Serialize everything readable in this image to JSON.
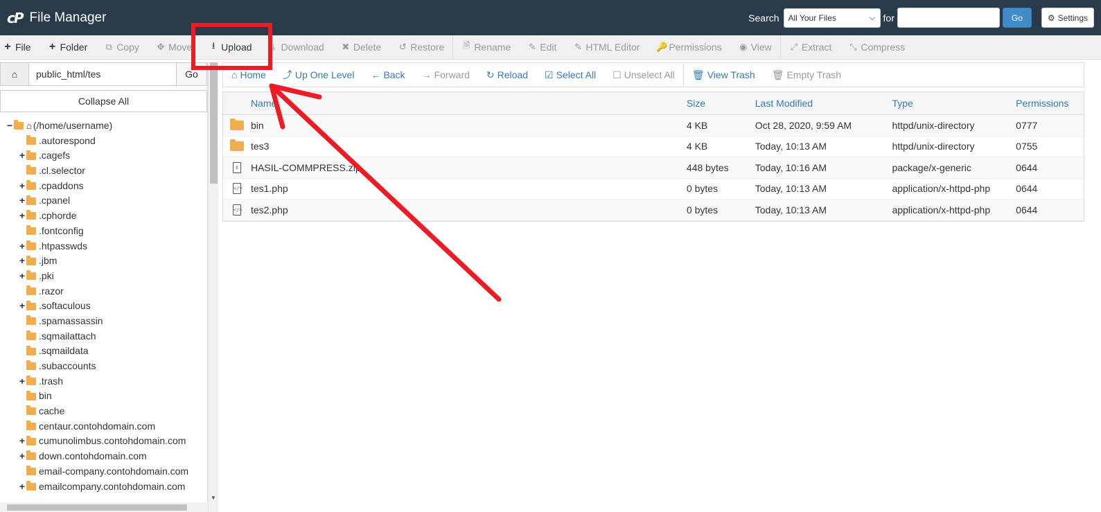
{
  "app": {
    "logo": "cP",
    "title": "File Manager"
  },
  "search": {
    "label": "Search",
    "scope": "All Your Files",
    "for_label": "for",
    "input_value": "",
    "go_label": "Go",
    "settings_label": "Settings"
  },
  "toolbar": {
    "file": "File",
    "folder": "Folder",
    "copy": "Copy",
    "move": "Move",
    "upload": "Upload",
    "download": "Download",
    "delete": "Delete",
    "restore": "Restore",
    "rename": "Rename",
    "edit": "Edit",
    "html_editor": "HTML Editor",
    "permissions": "Permissions",
    "view": "View",
    "extract": "Extract",
    "compress": "Compress"
  },
  "left": {
    "path": "public_html/tes",
    "go_label": "Go",
    "collapse_label": "Collapse All",
    "root": "(/home/username)",
    "tree": [
      {
        "name": ".autorespond",
        "toggle": ""
      },
      {
        "name": ".cagefs",
        "toggle": "+"
      },
      {
        "name": ".cl.selector",
        "toggle": ""
      },
      {
        "name": ".cpaddons",
        "toggle": "+"
      },
      {
        "name": ".cpanel",
        "toggle": "+"
      },
      {
        "name": ".cphorde",
        "toggle": "+"
      },
      {
        "name": ".fontconfig",
        "toggle": ""
      },
      {
        "name": ".htpasswds",
        "toggle": "+"
      },
      {
        "name": ".jbm",
        "toggle": "+"
      },
      {
        "name": ".pki",
        "toggle": "+"
      },
      {
        "name": ".razor",
        "toggle": ""
      },
      {
        "name": ".softaculous",
        "toggle": "+"
      },
      {
        "name": ".spamassassin",
        "toggle": ""
      },
      {
        "name": ".sqmailattach",
        "toggle": ""
      },
      {
        "name": ".sqmaildata",
        "toggle": ""
      },
      {
        "name": ".subaccounts",
        "toggle": ""
      },
      {
        "name": ".trash",
        "toggle": "+"
      },
      {
        "name": "bin",
        "toggle": ""
      },
      {
        "name": "cache",
        "toggle": ""
      },
      {
        "name": "centaur.contohdomain.com",
        "toggle": ""
      },
      {
        "name": "cumunolimbus.contohdomain.com",
        "toggle": "+"
      },
      {
        "name": "down.contohdomain.com",
        "toggle": "+"
      },
      {
        "name": "email-company.contohdomain.com",
        "toggle": ""
      },
      {
        "name": "emailcompany.contohdomain.com",
        "toggle": "+"
      }
    ]
  },
  "nav": {
    "home": "Home",
    "up": "Up One Level",
    "back": "Back",
    "forward": "Forward",
    "reload": "Reload",
    "select_all": "Select All",
    "unselect_all": "Unselect All",
    "view_trash": "View Trash",
    "empty_trash": "Empty Trash"
  },
  "table": {
    "headers": {
      "name": "Name",
      "size": "Size",
      "modified": "Last Modified",
      "type": "Type",
      "perms": "Permissions"
    },
    "rows": [
      {
        "icon": "folder-icon",
        "name": "bin",
        "size": "4 KB",
        "modified": "Oct 28, 2020, 9:59 AM",
        "type": "httpd/unix-directory",
        "perms": "0777"
      },
      {
        "icon": "folder-icon",
        "name": "tes3",
        "size": "4 KB",
        "modified": "Today, 10:13 AM",
        "type": "httpd/unix-directory",
        "perms": "0755"
      },
      {
        "icon": "zip-file-icon",
        "name": "HASIL-COMMPRESS.zip",
        "size": "448 bytes",
        "modified": "Today, 10:16 AM",
        "type": "package/x-generic",
        "perms": "0644"
      },
      {
        "icon": "code-file-icon",
        "name": "tes1.php",
        "size": "0 bytes",
        "modified": "Today, 10:13 AM",
        "type": "application/x-httpd-php",
        "perms": "0644"
      },
      {
        "icon": "code-file-icon",
        "name": "tes2.php",
        "size": "0 bytes",
        "modified": "Today, 10:13 AM",
        "type": "application/x-httpd-php",
        "perms": "0644"
      }
    ]
  },
  "colors": {
    "topbar": "#293a4a",
    "link": "#337ab7",
    "folder": "#f0ad4e",
    "annotation": "#ed1c24"
  }
}
